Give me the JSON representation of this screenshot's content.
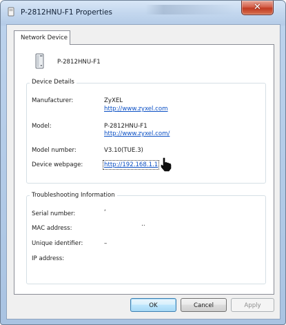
{
  "window": {
    "title": "P-2812HNU-F1 Properties",
    "close_glyph": "✕"
  },
  "tabs": [
    {
      "label": "Network Device"
    }
  ],
  "device": {
    "name": "P-2812HNU-F1",
    "icon": "network-device-icon"
  },
  "device_details": {
    "legend": "Device Details",
    "manufacturer": {
      "label": "Manufacturer:",
      "value": "ZyXEL",
      "link": "http://www.zyxel.com"
    },
    "model": {
      "label": "Model:",
      "value": "P-2812HNU-F1",
      "link": "http://www.zyxel.com/"
    },
    "model_number": {
      "label": "Model number:",
      "value": "V3.10(TUE.3)"
    },
    "device_webpage": {
      "label": "Device webpage:",
      "link": "http://192.168.1.1"
    }
  },
  "troubleshooting": {
    "legend": "Troubleshooting Information",
    "serial_number": {
      "label": "Serial number:",
      "value": "‘"
    },
    "mac_address": {
      "label": "MAC address:",
      "value": "‥"
    },
    "unique_identifier": {
      "label": "Unique identifier:",
      "value": "–"
    },
    "ip_address": {
      "label": "IP address:",
      "value": ""
    }
  },
  "buttons": {
    "ok": "OK",
    "cancel": "Cancel",
    "apply": "Apply"
  },
  "colors": {
    "link": "#0a4fc4",
    "close_button": "#c13b22",
    "default_button_border": "#3c7fb1"
  }
}
